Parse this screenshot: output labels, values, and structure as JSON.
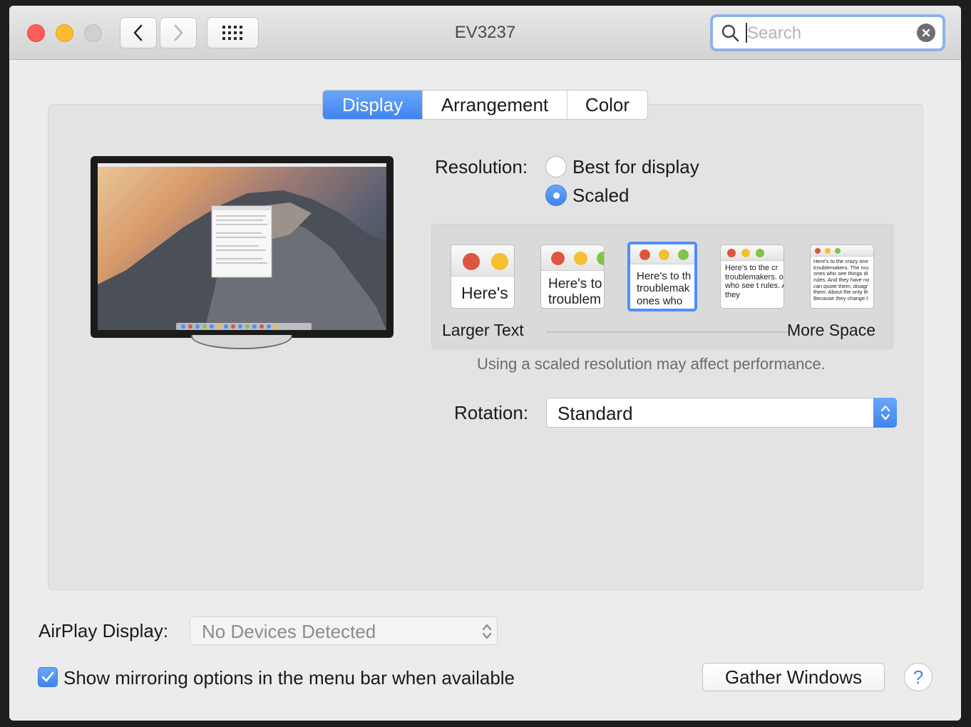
{
  "window": {
    "title": "EV3237"
  },
  "toolbar": {
    "search_placeholder": "Search"
  },
  "tabs": [
    {
      "label": "Display",
      "active": true
    },
    {
      "label": "Arrangement",
      "active": false
    },
    {
      "label": "Color",
      "active": false
    }
  ],
  "resolution": {
    "label": "Resolution:",
    "options": [
      {
        "label": "Best for display",
        "selected": false
      },
      {
        "label": "Scaled",
        "selected": true
      }
    ]
  },
  "scaled_options": {
    "selected_index": 2,
    "thumbs": [
      {
        "text": "Here's"
      },
      {
        "text": "Here's to troublem"
      },
      {
        "text": "Here's to th troublemak ones who"
      },
      {
        "text": "Here's to the cr troublemakers. ones who see t rules. And they"
      },
      {
        "text": "Here's to the crazy one troublemakers. The rou ones who see things di rules. And they have no can quote them, disagr them. About the only th Because they change t"
      }
    ],
    "min_label": "Larger Text",
    "max_label": "More Space"
  },
  "performance_note": "Using a scaled resolution may affect performance.",
  "rotation": {
    "label": "Rotation:",
    "value": "Standard"
  },
  "airplay": {
    "label": "AirPlay Display:",
    "value": "No Devices Detected"
  },
  "mirroring": {
    "label": "Show mirroring options in the menu bar when available",
    "checked": true
  },
  "buttons": {
    "gather_windows": "Gather Windows",
    "help": "?"
  },
  "colors": {
    "accent": "#3f84f0",
    "close": "#fc5f57",
    "minimize": "#fdbc2e"
  }
}
